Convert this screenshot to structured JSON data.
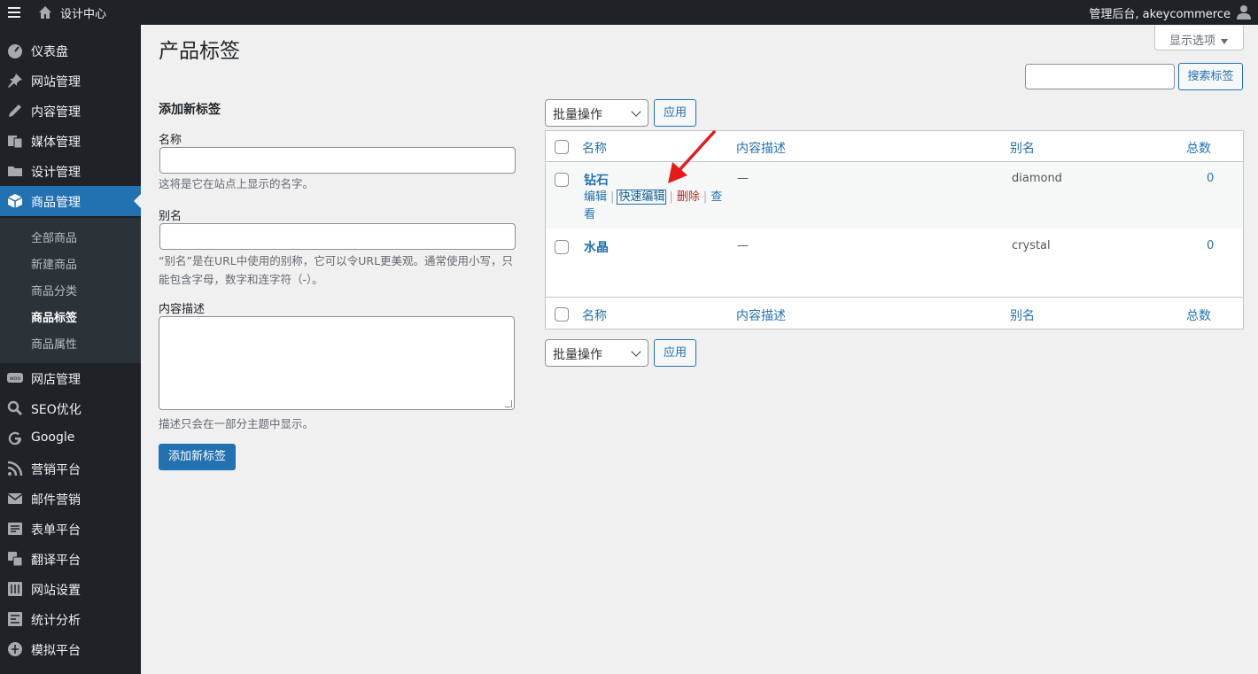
{
  "adminbar": {
    "site_name": "设计中心",
    "account": "管理后台, akeycommerce",
    "menu_icon": "hamburger-icon",
    "home_icon": "home-icon",
    "user_icon": "user-avatar-icon"
  },
  "sidebar": {
    "items": [
      {
        "label": "仪表盘",
        "icon": "dashboard-icon"
      },
      {
        "label": "网站管理",
        "icon": "pin-icon"
      },
      {
        "label": "内容管理",
        "icon": "pencil-icon"
      },
      {
        "label": "媒体管理",
        "icon": "media-icon"
      },
      {
        "label": "设计管理",
        "icon": "folder-icon"
      },
      {
        "label": "商品管理",
        "icon": "box-icon"
      },
      {
        "label": "网店管理",
        "icon": "woo-icon"
      },
      {
        "label": "SEO优化",
        "icon": "search-icon"
      },
      {
        "label": "Google",
        "icon": "google-icon"
      },
      {
        "label": "营销平台",
        "icon": "rss-icon"
      },
      {
        "label": "邮件营销",
        "icon": "mail-icon"
      },
      {
        "label": "表单平台",
        "icon": "form-icon"
      },
      {
        "label": "翻译平台",
        "icon": "translate-icon"
      },
      {
        "label": "网站设置",
        "icon": "settings-icon"
      },
      {
        "label": "统计分析",
        "icon": "stats-icon"
      },
      {
        "label": "模拟平台",
        "icon": "globe-icon"
      }
    ],
    "submenu": [
      "全部商品",
      "新建商品",
      "商品分类",
      "商品标签",
      "商品属性"
    ]
  },
  "page": {
    "title": "产品标签",
    "screen_options": "显示选项",
    "search_button": "搜索标签"
  },
  "form": {
    "heading": "添加新标签",
    "name_label": "名称",
    "name_hint": "这将是它在站点上显示的名字。",
    "slug_label": "别名",
    "slug_hint": "“别名”是在URL中使用的别称，它可以令URL更美观。通常使用小写，只能包含字母，数字和连字符（-）。",
    "desc_label": "内容描述",
    "desc_hint": "描述只会在一部分主题中显示。",
    "submit": "添加新标签"
  },
  "bulk": {
    "select_value": "批量操作",
    "apply": "应用"
  },
  "table": {
    "columns": [
      "名称",
      "内容描述",
      "别名",
      "总数"
    ],
    "rows": [
      {
        "name": "钻石",
        "description": "—",
        "slug": "diamond",
        "count": "0"
      },
      {
        "name": "水晶",
        "description": "—",
        "slug": "crystal",
        "count": "0"
      }
    ],
    "row_actions": {
      "edit": "编辑",
      "quick_edit": "快速编辑",
      "delete": "删除",
      "view": "查看"
    }
  },
  "colors": {
    "accent": "#2271b1",
    "sidebar": "#1d2327",
    "danger": "#b32d2e",
    "annotation_arrow": "#e8191a"
  }
}
